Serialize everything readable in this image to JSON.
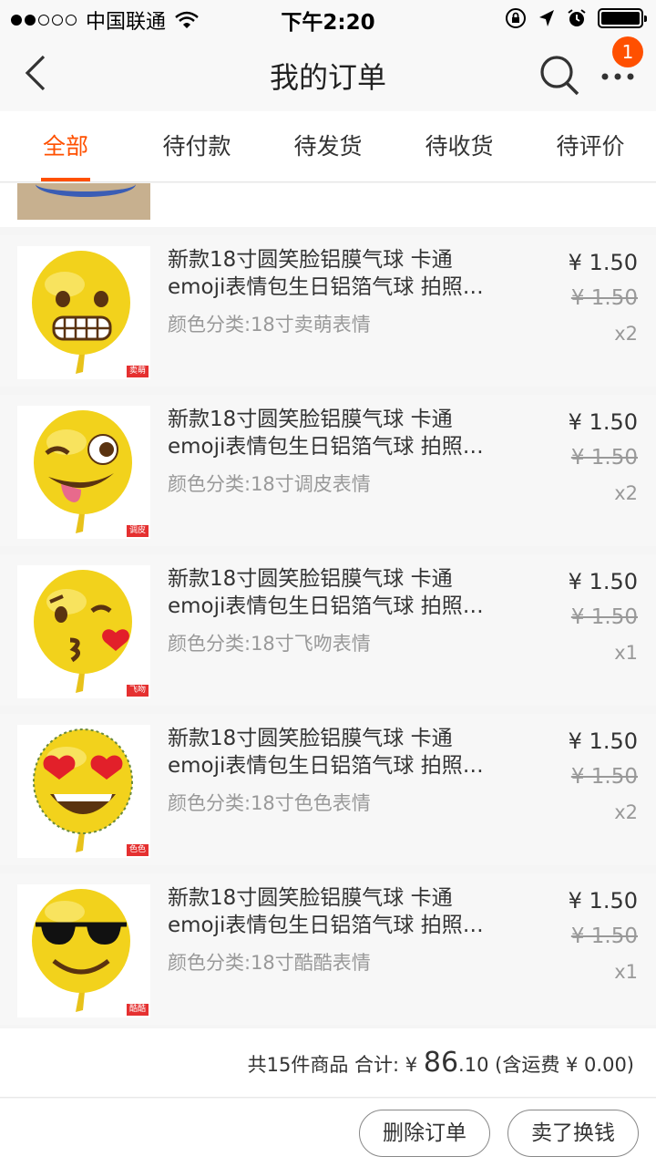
{
  "status_bar": {
    "carrier": "中国联通",
    "time": "下午2:20"
  },
  "nav": {
    "title": "我的订单",
    "badge_count": "1"
  },
  "tabs": [
    {
      "label": "全部",
      "active": true
    },
    {
      "label": "待付款",
      "active": false
    },
    {
      "label": "待发货",
      "active": false
    },
    {
      "label": "待收货",
      "active": false
    },
    {
      "label": "待评价",
      "active": false
    }
  ],
  "items": [
    {
      "title_line1": "新款18寸圆笑脸铝膜气球 卡通",
      "title_line2": "emoji表情包生日铝箔气球 拍照…",
      "sku": "颜色分类:18寸卖萌表情",
      "price": "¥ 1.50",
      "original_price": "¥ 1.50",
      "quantity": "x2",
      "tag": "卖萌",
      "icon": "grimace-emoji-balloon-icon"
    },
    {
      "title_line1": "新款18寸圆笑脸铝膜气球 卡通",
      "title_line2": "emoji表情包生日铝箔气球 拍照…",
      "sku": "颜色分类:18寸调皮表情",
      "price": "¥ 1.50",
      "original_price": "¥ 1.50",
      "quantity": "x2",
      "tag": "调皮",
      "icon": "wink-tongue-emoji-balloon-icon"
    },
    {
      "title_line1": "新款18寸圆笑脸铝膜气球 卡通",
      "title_line2": "emoji表情包生日铝箔气球 拍照…",
      "sku": "颜色分类:18寸飞吻表情",
      "price": "¥ 1.50",
      "original_price": "¥ 1.50",
      "quantity": "x1",
      "tag": "飞吻",
      "icon": "kiss-emoji-balloon-icon"
    },
    {
      "title_line1": "新款18寸圆笑脸铝膜气球 卡通",
      "title_line2": "emoji表情包生日铝箔气球 拍照…",
      "sku": "颜色分类:18寸色色表情",
      "price": "¥ 1.50",
      "original_price": "¥ 1.50",
      "quantity": "x2",
      "tag": "色色",
      "icon": "heart-eyes-emoji-balloon-icon"
    },
    {
      "title_line1": "新款18寸圆笑脸铝膜气球 卡通",
      "title_line2": "emoji表情包生日铝箔气球 拍照…",
      "sku": "颜色分类:18寸酷酷表情",
      "price": "¥ 1.50",
      "original_price": "¥ 1.50",
      "quantity": "x1",
      "tag": "酷酷",
      "icon": "sunglasses-emoji-balloon-icon"
    }
  ],
  "summary": {
    "count_text": "共15件商品 合计:",
    "currency": "¥",
    "total_int": "86",
    "total_dec": ".10",
    "shipping": "(含运费 ¥ 0.00)"
  },
  "actions": {
    "delete_label": "删除订单",
    "sell_label": "卖了换钱"
  },
  "colors": {
    "accent": "#ff5000",
    "balloon_yellow": "#f2d21c"
  }
}
